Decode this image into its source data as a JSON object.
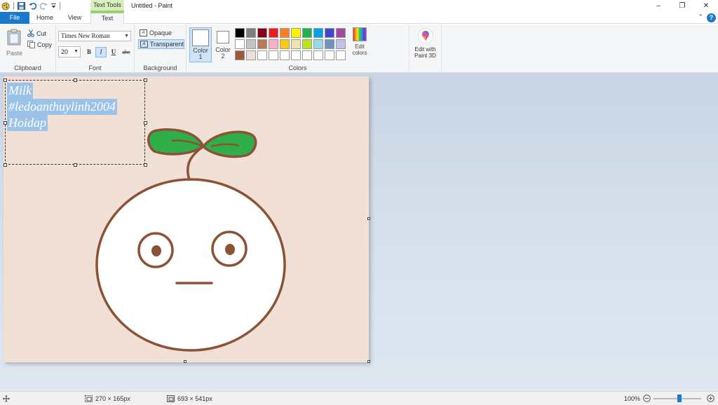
{
  "window": {
    "title": "Untitled - Paint",
    "context_tab": "Text Tools",
    "controls": [
      "–",
      "❐",
      "✕"
    ]
  },
  "tabs": {
    "file": "File",
    "home": "Home",
    "view": "View",
    "text": "Text"
  },
  "help": "?",
  "ribbon": {
    "clipboard": {
      "label": "Clipboard",
      "paste": "Paste",
      "cut": "Cut",
      "copy": "Copy"
    },
    "font": {
      "label": "Font",
      "family": "Times New Roman",
      "size": "20",
      "bold": "B",
      "italic": "I",
      "underline": "U",
      "strikethrough": "abc"
    },
    "background": {
      "label": "Background",
      "opaque": "Opaque",
      "transparent": "Transparent"
    },
    "colors": {
      "label": "Colors",
      "color1": "Color 1",
      "color2": "Color 2",
      "color1_value": "#ffffff",
      "color2_value": "#ffffff",
      "palette": [
        "#000000",
        "#7f7f7f",
        "#880015",
        "#ed1c24",
        "#ff7f27",
        "#fff200",
        "#22b14c",
        "#00a2e8",
        "#3f48cc",
        "#a349a4",
        "#ffffff",
        "#c3c3c3",
        "#b97a57",
        "#ffaec9",
        "#ffc90e",
        "#efe4b0",
        "#b5e61d",
        "#99d9ea",
        "#7092be",
        "#c8bfe7",
        "#9b5b3a",
        "#f0dfd5",
        "#ffffff",
        "#ffffff",
        "#ffffff",
        "#ffffff",
        "#ffffff",
        "#ffffff",
        "#ffffff",
        "#ffffff"
      ],
      "edit_colors": "Edit colors"
    },
    "paint3d": "Edit with Paint 3D"
  },
  "canvas": {
    "background": "#f0e0d6",
    "text_lines": [
      "Milk",
      "#ledoanthuylinh2004",
      "Hoidap"
    ]
  },
  "status": {
    "selection_size": "270 × 165px",
    "image_size": "693 × 541px",
    "zoom": "100%"
  }
}
